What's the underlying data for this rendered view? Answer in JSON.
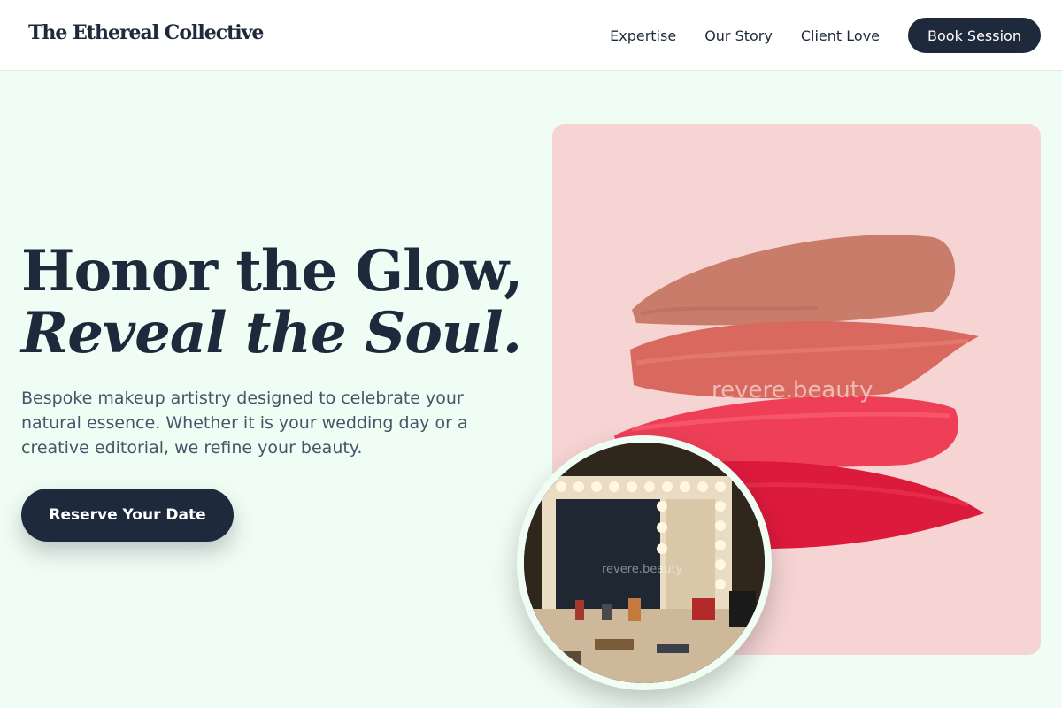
{
  "header": {
    "brand": "The Ethereal Collective",
    "nav": [
      "Expertise",
      "Our Story",
      "Client Love"
    ],
    "cta": "Book Session"
  },
  "hero": {
    "title_line1": "Honor the Glow,",
    "title_line2": "Reveal the Soul.",
    "description": "Bespoke makeup artistry designed to celebrate your natural essence. Whether it is your wedding day or a creative editorial, we refine your beauty.",
    "cta": "Reserve Your Date"
  },
  "images": {
    "swatch_watermark": "revere.beauty",
    "mirror_watermark": "revere.beauty"
  },
  "colors": {
    "background": "#f0fdf4",
    "primary": "#1e293b",
    "swatch_bg": "#f6d4d4"
  }
}
